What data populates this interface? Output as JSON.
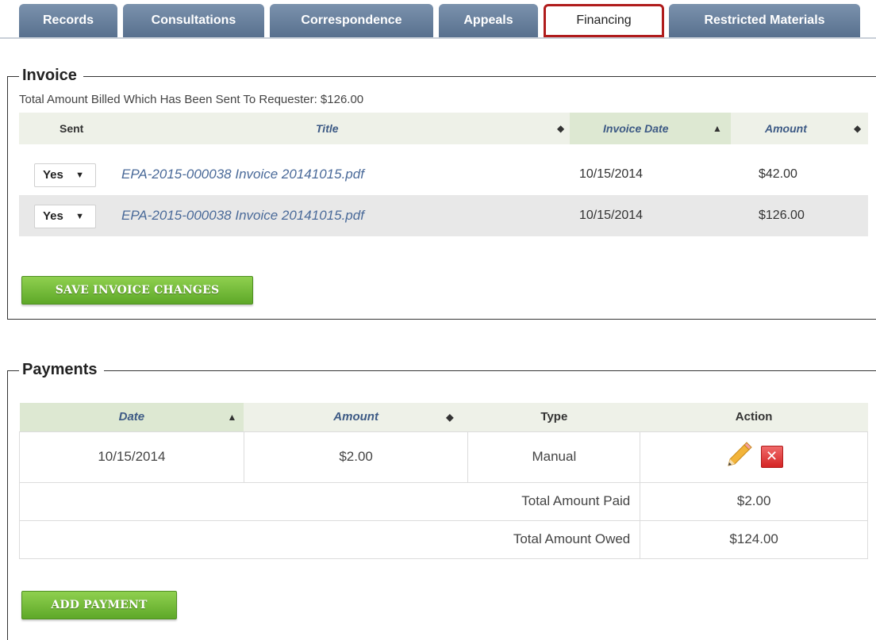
{
  "tabs": [
    {
      "label": "Records"
    },
    {
      "label": "Consultations"
    },
    {
      "label": "Correspondence"
    },
    {
      "label": "Appeals"
    },
    {
      "label": "Financing"
    },
    {
      "label": "Restricted Materials"
    }
  ],
  "active_tab": "Financing",
  "invoice": {
    "legend": "Invoice",
    "summary": "Total Amount Billed Which Has Been Sent To Requester: $126.00",
    "columns": {
      "sent": "Sent",
      "title": "Title",
      "invoice_date": "Invoice Date",
      "amount": "Amount"
    },
    "rows": [
      {
        "sent": "Yes",
        "title": "EPA-2015-000038 Invoice 20141015.pdf",
        "date": "10/15/2014",
        "amount": "$42.00"
      },
      {
        "sent": "Yes",
        "title": "EPA-2015-000038 Invoice 20141015.pdf",
        "date": "10/15/2014",
        "amount": "$126.00"
      }
    ],
    "save_button": "SAVE INVOICE CHANGES"
  },
  "payments": {
    "legend": "Payments",
    "columns": {
      "date": "Date",
      "amount": "Amount",
      "type": "Type",
      "action": "Action"
    },
    "rows": [
      {
        "date": "10/15/2014",
        "amount": "$2.00",
        "type": "Manual"
      }
    ],
    "total_paid_label": "Total Amount Paid",
    "total_paid": "$2.00",
    "total_owed_label": "Total Amount Owed",
    "total_owed": "$124.00",
    "add_button": "ADD PAYMENT"
  },
  "icons": {
    "sort_both": "sort-both-icon",
    "sort_asc": "sort-asc-icon",
    "edit": "pencil-icon",
    "delete": "delete-x-icon"
  },
  "colors": {
    "tab_bg": "#58708e",
    "active_border": "#b01c1c",
    "button_green": "#5ea828",
    "header_bg": "#eef1e8",
    "link": "#4a6a99"
  }
}
